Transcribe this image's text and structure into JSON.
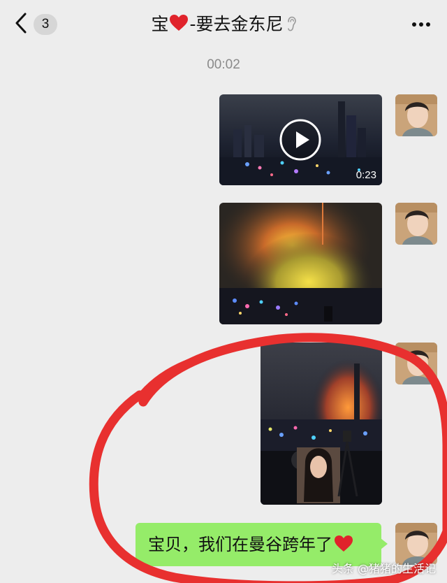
{
  "header": {
    "back_icon": "chevron-left-icon",
    "unread_count": "3",
    "title_prefix": "宝",
    "title_suffix": "-要去金东尼",
    "title_heart_icon": "red-heart-icon",
    "title_ear_icon": "ear-icon",
    "more_icon": "more-dots-icon"
  },
  "chat": {
    "timestamp": "00:02",
    "messages": [
      {
        "type": "video",
        "duration": "0:23",
        "play_icon": "play-icon"
      },
      {
        "type": "image"
      },
      {
        "type": "image"
      },
      {
        "type": "text",
        "text": "宝贝，我们在曼谷跨年了",
        "heart_icon": "red-heart-icon"
      }
    ]
  },
  "annotation": {
    "color": "#e8302f"
  },
  "colors": {
    "background": "#ededed",
    "bubble_green": "#95ec69"
  },
  "watermark": "头条 @猪猪的生活记"
}
